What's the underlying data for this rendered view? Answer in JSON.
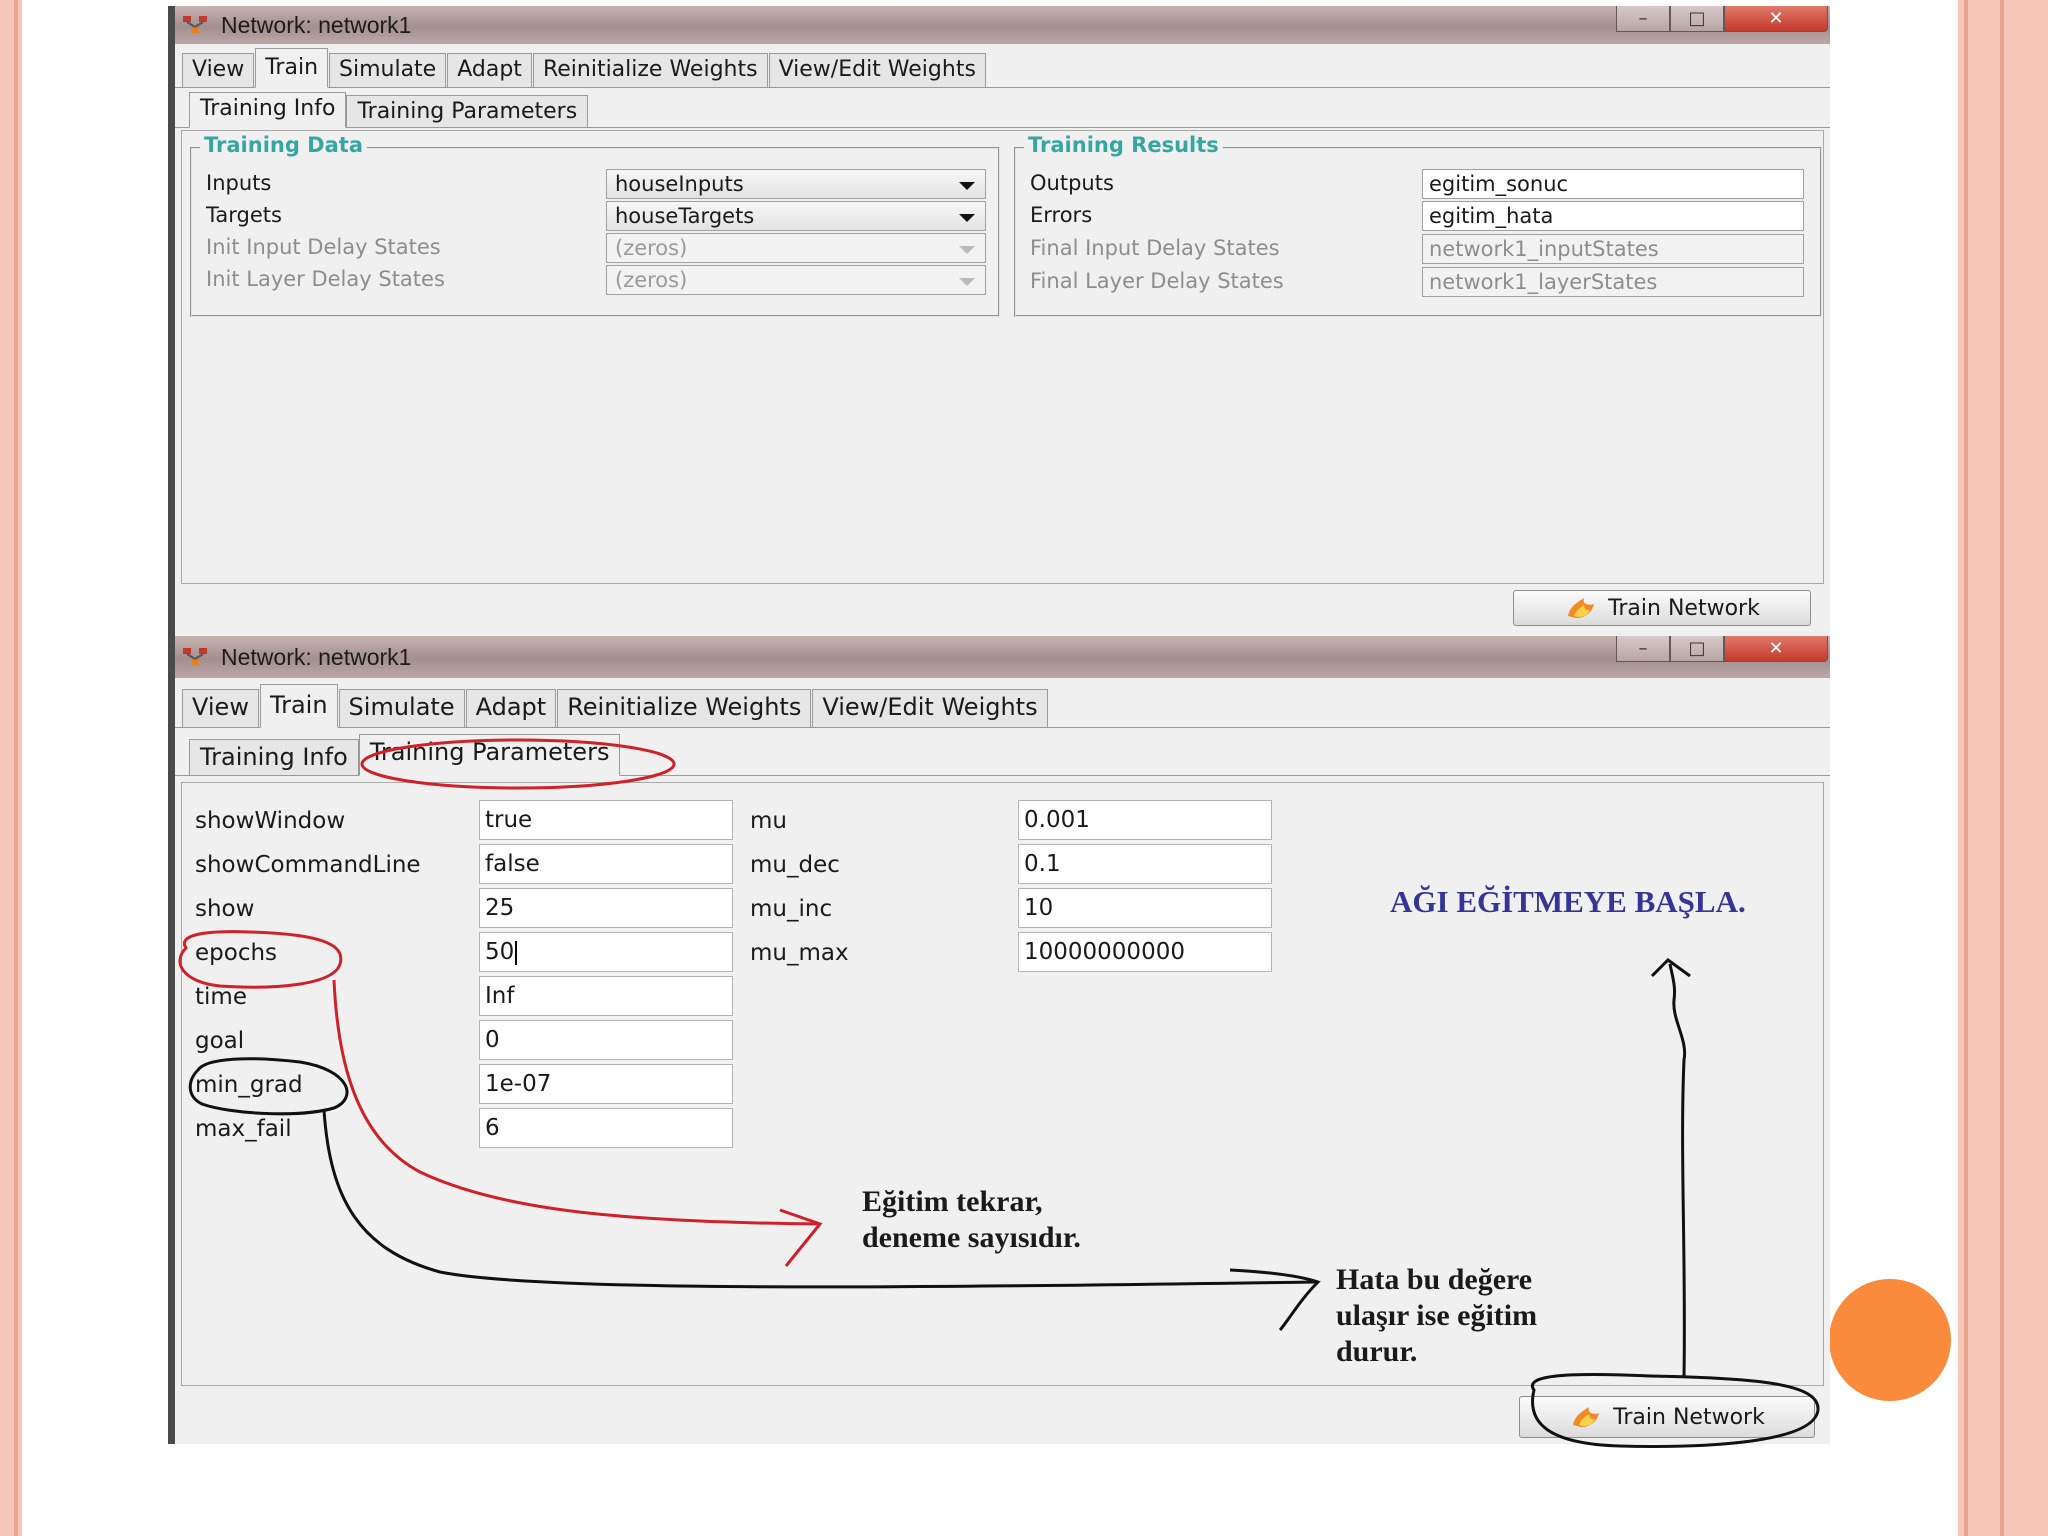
{
  "window_title": "Network: network1",
  "tabs": [
    "View",
    "Train",
    "Simulate",
    "Adapt",
    "Reinitialize Weights",
    "View/Edit Weights"
  ],
  "subtabs": [
    "Training Info",
    "Training Parameters"
  ],
  "training_data": {
    "title": "Training Data",
    "rows": [
      {
        "label": "Inputs",
        "value": "houseInputs"
      },
      {
        "label": "Targets",
        "value": "houseTargets"
      },
      {
        "label": "Init Input Delay States",
        "value": "(zeros)"
      },
      {
        "label": "Init Layer Delay States",
        "value": "(zeros)"
      }
    ]
  },
  "training_results": {
    "title": "Training Results",
    "rows": [
      {
        "label": "Outputs",
        "value": "egitim_sonuc"
      },
      {
        "label": "Errors",
        "value": "egitim_hata"
      },
      {
        "label": "Final Input Delay States",
        "value": "network1_inputStates"
      },
      {
        "label": "Final Layer Delay States",
        "value": "network1_layerStates"
      }
    ]
  },
  "train_button_label": "Train Network",
  "params_left": [
    {
      "label": "showWindow",
      "value": "true"
    },
    {
      "label": "showCommandLine",
      "value": "false"
    },
    {
      "label": "show",
      "value": "25"
    },
    {
      "label": "epochs",
      "value": "50"
    },
    {
      "label": "time",
      "value": "Inf"
    },
    {
      "label": "goal",
      "value": "0"
    },
    {
      "label": "min_grad",
      "value": "1e-07"
    },
    {
      "label": "max_fail",
      "value": "6"
    }
  ],
  "params_right": [
    {
      "label": "mu",
      "value": "0.001"
    },
    {
      "label": "mu_dec",
      "value": "0.1"
    },
    {
      "label": "mu_inc",
      "value": "10"
    },
    {
      "label": "mu_max",
      "value": "10000000000"
    }
  ],
  "annotations": {
    "start_training": "AĞI EĞİTMEYE BAŞLA.",
    "epochs_note": [
      "Eğitim tekrar,",
      "deneme sayısıdır."
    ],
    "min_grad_note": [
      "Hata bu değere",
      "ulaşır ise eğitim",
      "durur."
    ]
  },
  "colors": {
    "accent_teal": "#38a6a0",
    "annotation_red": "#d0202a",
    "annotation_blue": "#343597",
    "slide_stripe": "#f6c7b8",
    "dot_orange": "#fa8a3c"
  },
  "icons": [
    "app-network-icon",
    "flame-icon",
    "minimize-icon",
    "maximize-icon",
    "close-icon"
  ]
}
